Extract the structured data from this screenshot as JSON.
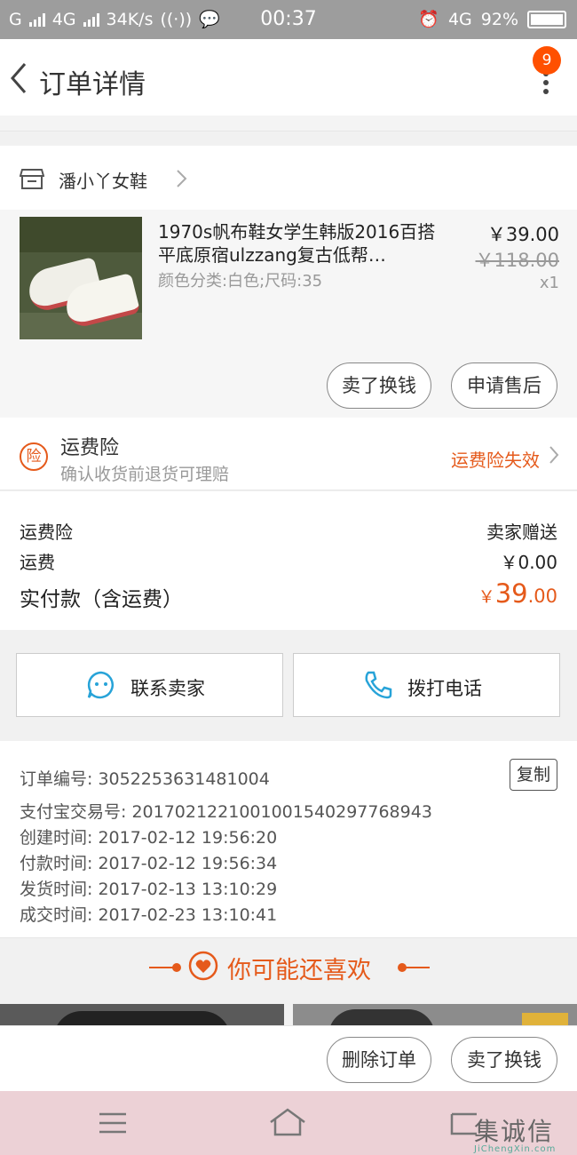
{
  "status_bar": {
    "carrier1": "G",
    "network": "4G",
    "speed": "34K/s",
    "time": "00:37",
    "network2": "4G",
    "battery": "92%"
  },
  "nav": {
    "title": "订单详情",
    "badge": "9"
  },
  "shop": {
    "name": "潘小丫女鞋"
  },
  "item": {
    "title": "1970s帆布鞋女学生韩版2016百搭平底原宿ulzzang复古低帮…",
    "sku": "颜色分类:白色;尺码:35",
    "price": "￥39.00",
    "original_price": "￥118.00",
    "quantity": "x1",
    "btn_sell": "卖了换钱",
    "btn_aftersale": "申请售后"
  },
  "insurance": {
    "icon_text": "险",
    "title": "运费险",
    "subtitle": "确认收货前退货可理赔",
    "status": "运费险失效"
  },
  "fees": {
    "insurance_label": "运费险",
    "insurance_value": "卖家赠送",
    "shipping_label": "运费",
    "shipping_value": "￥0.00",
    "paid_label": "实付款（含运费）",
    "paid_currency": "￥",
    "paid_int": "39",
    "paid_dec": ".00"
  },
  "actions": {
    "contact": "联系卖家",
    "call": "拨打电话"
  },
  "order_info": {
    "order_no": "订单编号: 3052253631481004",
    "copy": "复制",
    "alipay_no": "支付宝交易号: 2017021221001001540297768943",
    "created": "创建时间: 2017-02-12 19:56:20",
    "paid": "付款时间: 2017-02-12 19:56:34",
    "shipped": "发货时间: 2017-02-13 13:10:29",
    "completed": "成交时间: 2017-02-23 13:10:41"
  },
  "recommend": {
    "title": "你可能还喜欢"
  },
  "bottom": {
    "delete": "删除订单",
    "sell": "卖了换钱"
  },
  "watermark": {
    "text": "集诚信",
    "url": "JiChengXin.com"
  },
  "colors": {
    "accent": "#e55a1b",
    "badge": "#ff5000",
    "status_bar": "#9d9d9d"
  }
}
